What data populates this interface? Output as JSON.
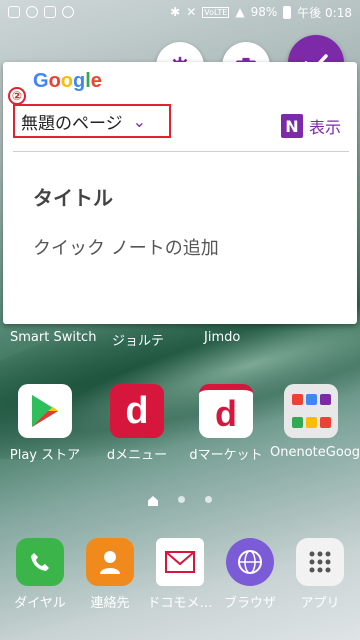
{
  "status_bar": {
    "battery": "98%",
    "time": "午後 0:18"
  },
  "card": {
    "google_logo": "Google",
    "page_selector": "無題のページ",
    "step_badge": "②",
    "onenote_action": "表示",
    "note_title": "タイトル",
    "note_placeholder": "クイック ノートの追加"
  },
  "behind_card_labels": [
    "Smart Switch",
    "ジョルテ",
    "Jimdo"
  ],
  "apps_row": [
    {
      "label": "Play ストア",
      "icon": "play-store-icon"
    },
    {
      "label": "dメニュー",
      "icon": "dmenu-icon"
    },
    {
      "label": "dマーケット",
      "icon": "dmarket-icon"
    },
    {
      "label": "OnenoteGoogle",
      "icon": "folder-icon"
    }
  ],
  "dock": [
    {
      "label": "ダイヤル",
      "icon": "phone-icon"
    },
    {
      "label": "連絡先",
      "icon": "contacts-icon"
    },
    {
      "label": "ドコモメ…",
      "icon": "mail-icon"
    },
    {
      "label": "ブラウザ",
      "icon": "browser-icon"
    },
    {
      "label": "アプリ",
      "icon": "apps-icon"
    }
  ],
  "colors": {
    "accent": "#7c2aa8",
    "highlight": "#e0232f"
  }
}
